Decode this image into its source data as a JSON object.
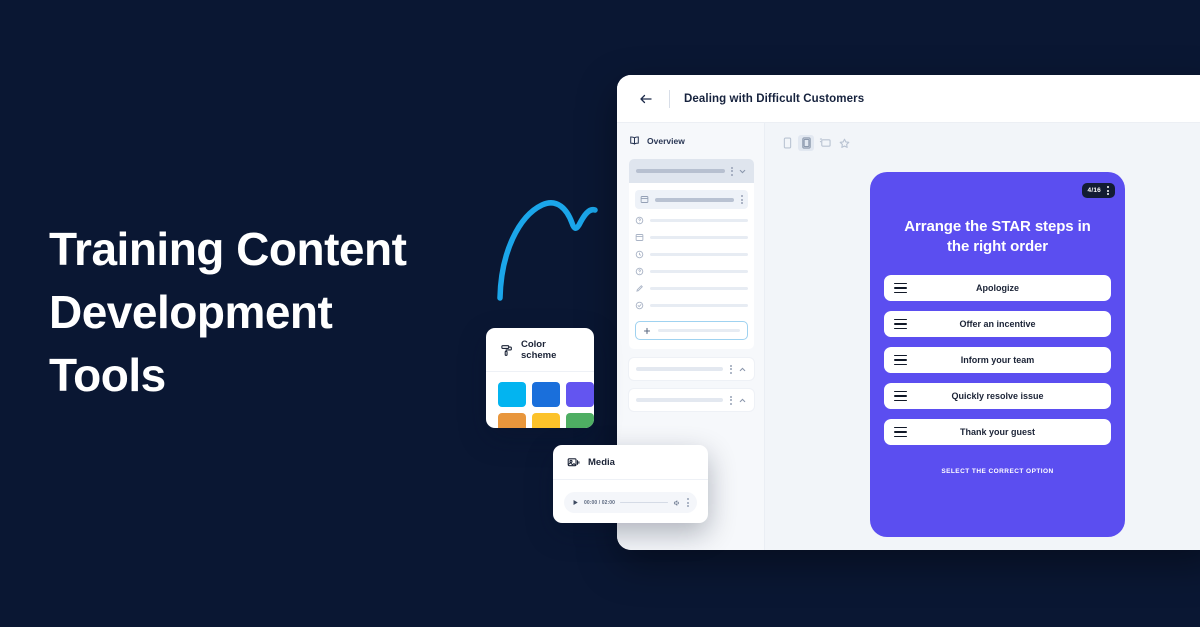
{
  "page": {
    "background_color": "#0a1733",
    "headline_lines": [
      "Training Content",
      "Development",
      "Tools"
    ]
  },
  "decoration": {
    "arrow_icon": "curved-arrow-doodle",
    "arrow_color": "#1ba6ea"
  },
  "app": {
    "topbar": {
      "back_icon": "arrow-left-icon",
      "title": "Dealing with Difficult Customers"
    },
    "sidebar": {
      "header_icon": "book-icon",
      "header_label": "Overview",
      "group": {
        "menu_icon": "more-vertical-icon",
        "collapse_icon": "chevron-down-icon",
        "rows": [
          {
            "icon": "slide-icon",
            "highlighted": true
          },
          {
            "icon": "question-circle-icon",
            "highlighted": false
          },
          {
            "icon": "slide-icon",
            "highlighted": false
          },
          {
            "icon": "clock-icon",
            "highlighted": false
          },
          {
            "icon": "question-circle-icon",
            "highlighted": false
          },
          {
            "icon": "pencil-icon",
            "highlighted": false
          },
          {
            "icon": "check-circle-icon",
            "highlighted": false
          }
        ],
        "add_row_icon": "plus-icon"
      },
      "extra_cards": [
        {
          "menu_icon": "more-vertical-icon",
          "collapse_icon": "chevron-up-icon"
        },
        {
          "menu_icon": "more-vertical-icon",
          "collapse_icon": "chevron-up-icon"
        }
      ]
    },
    "view_toolbar": {
      "buttons": [
        {
          "icon": "mobile-view-icon",
          "active": false
        },
        {
          "icon": "tablet-view-icon",
          "active": true
        },
        {
          "icon": "desktop-view-icon",
          "active": false
        },
        {
          "icon": "star-icon",
          "active": false
        }
      ]
    },
    "quiz": {
      "accent_color": "#5b4ef0",
      "badge": {
        "counter": "4/16",
        "menu_icon": "more-vertical-icon",
        "background_color": "#131c33"
      },
      "title": "Arrange the STAR steps in the right order",
      "items": [
        {
          "label": "Apologize",
          "handle_icon": "drag-handle-icon"
        },
        {
          "label": "Offer an incentive",
          "handle_icon": "drag-handle-icon"
        },
        {
          "label": "Inform your team",
          "handle_icon": "drag-handle-icon"
        },
        {
          "label": "Quickly resolve issue",
          "handle_icon": "drag-handle-icon"
        },
        {
          "label": "Thank your guest",
          "handle_icon": "drag-handle-icon"
        }
      ],
      "hint": "SELECT THE CORRECT OPTION"
    }
  },
  "color_scheme_card": {
    "icon": "paint-roller-icon",
    "title": "Color scheme",
    "swatches": [
      {
        "name": "cyan",
        "color": "#03b4f0"
      },
      {
        "name": "blue",
        "color": "#1a6fdb"
      },
      {
        "name": "violet",
        "color": "#6355f0"
      },
      {
        "name": "orange",
        "color": "#e8963c"
      },
      {
        "name": "yellow",
        "color": "#fcc22a"
      },
      {
        "name": "green",
        "color": "#4eae63"
      }
    ]
  },
  "media_card": {
    "icon": "media-image-icon",
    "title": "Media",
    "player": {
      "play_icon": "play-icon",
      "time": "00:00 / 02:00",
      "volume_icon": "volume-icon",
      "menu_icon": "more-vertical-icon"
    }
  }
}
